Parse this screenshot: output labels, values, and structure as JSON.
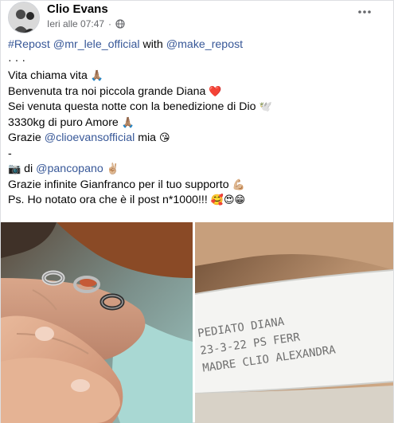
{
  "post": {
    "author": "Clio Evans",
    "timestamp": "Ieri alle 07:47",
    "privacy_icon": "globe-icon",
    "more_icon": "more-horizontal-icon"
  },
  "content": {
    "line1": {
      "hashtag": "#Repost",
      "mention1": "@mr_lele_official",
      "middle": " with ",
      "mention2": "@make_repost"
    },
    "dots": "·  ·  ·",
    "line3": "Vita chiama vita",
    "line3_emoji": "🙏🏽",
    "line4": "Benvenuta tra noi piccola grande Diana",
    "line4_emoji": "❤️",
    "line5": "Sei venuta questa notte con la benedizione di Dio",
    "line5_emoji": "🕊️",
    "line6": "3330kg di puro Amore",
    "line6_emoji": "🙏🏽",
    "line7_prefix": "Grazie ",
    "line7_mention": "@clioevansofficial",
    "line7_suffix": " mia",
    "line7_emoji": "😘",
    "dash": "-",
    "line9_emoji_camera": "📷",
    "line9_prefix": " di ",
    "line9_mention": "@pancopano",
    "line9_emoji": "✌🏼",
    "line10": "Grazie infinite Gianfranco per il tuo supporto",
    "line10_emoji": "💪🏼",
    "line11": "Ps. Ho notato ora che è il post n*1000!!!",
    "line11_emoji": "🥰😍😁"
  },
  "photos": {
    "left": {
      "description_icon": "hands-rings-photo"
    },
    "right": {
      "bracelet_text": [
        "PEDIATO DIANA",
        "23-3-22 PS FERR",
        "MADRE CLIO ALEXANDRA"
      ]
    }
  },
  "colors": {
    "link": "#385898",
    "text": "#050505",
    "secondary": "#65676b"
  }
}
